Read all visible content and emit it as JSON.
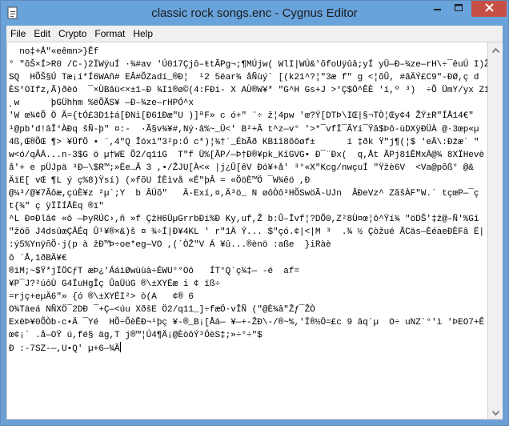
{
  "window": {
    "title": "classic rock songs.enc - Cygnus Editor",
    "controls": {
      "minimize_icon": "minimize-icon",
      "maximize_icon": "maximize-icon",
      "close_icon": "close-icon"
    }
  },
  "colors": {
    "titlebar": "#69a3dc",
    "close_button": "#c74f46",
    "editor_background": "#ffffff",
    "menubar_background": "#f0f0f0"
  },
  "menu": [
    "File",
    "Edit",
    "Crypto",
    "Format",
    "Help"
  ],
  "editor": {
    "lines": [
      "  no‡+Å\"«eêmn>}Êf",
      "° \"õŠ×Í>R0 /C-)2ÏWÿuÍ ·¾#av 'Ú017Çjô–ŧtÃPg¬;¶MÚjw( WlI|WÚ&'õfoUÿûâ;yÍ yÜ—Ð–¾ze—rH\\÷¯êuÚ I)Ž",
      "SQ  HÕŠ§Ú Tæ¡í*Í6WAñ# EÂ#ÕZadí_®Ð¦  ¹2 5ëar¾ åÑùý´ [(k21^?¦\"3æ f\" g <¦õÛ, #âÄÝ£C9\"-ÐØ,ç d",
      "ÈS°OIfz,Ã)ðèö  ¯×ÙBâü<×±1–Ð ¾Iï®ø©(4:FÐi- X AÙ®W¥* \"G^H Gs+J >°Ç$Ö^ÊÈ 'í,º ³)  ÷Õ ÜmY/yx Z1ÈŠ",
      "¸w      þGÜhhm %ëÕÃS¥ —Ð–¾ze—rHPÓ^x",
      "'W œ¾¢Õ Ö Ã={tÓ£3D1‡á[ÐNì[Ð61Ðæ\"U )]ªF» c ó+\" ¨÷ ž¦4pw 'œ?Ý[DTÞ\\IŒ|§¬TÒ¦Œy¢4 ŽÝ±R\"ÍÅ14€\"",
      "¹@pb'd!âÎ°ÀÐq šÑ-þ\" ¤:-  ·Ã§v¾¥#,Ný·â%~_Ü<' B²+Â t^z—v° '>*¯vfÏ¯ÃYí¯Ÿâ$Þô-ùDXÿÐÜÀ @·3œp«µ",
      "4ß,Œ®ÕŒ ¶> ¥ÜfÖ • ¨,4\"Q Îóxì\"3²p:Ó c*)¦¾†´_ÉbÃð KB1î8õôøf±      í ‡ðk Ÿ\"j¶(¦$ 'eÄ\\:Ðžæ´ \"",
      "w<ó/qÂÄ...n-3$G ö µ†WE Õ2/q11G  T\"f Ü%[ÃP/—Þ†Ð®¥pk_KîGVG• Ð¯¨Ðx(  q,Åt ÃPj81ÊMxÄ@¾ 8XÏHevè",
      "å'+ e pÜJpä ³Ð—\\$R™;»Ëe…Â 3 ,•/ŽJU[À<« |j¿Û[êV Ðó¥+å' ³°«X\"Kcg/nwçuÍ \"Ÿžè6V  <Va@põß° @&",
      "ÄïE[ vŒ ¶L ý ç%8)Ÿsí) (»fõU ÍÈìvå «É\"þÂ = «ÕöÈ™Ö ¯W¾êö ,Ð",
      "@¼³/@¥7Âôæ,çüÈ¥z ²µ`;Y  b ÂÚõ\"   Ä-Exí,¤,Ä³ö_ N øôÒô³HÕSwöÃ-UJn  ÂÐeVz^ ZãšÀF\"W.´ tçœP—¯ç",
      "t{¾\" ç ÿÏÏÍÅÈq ®ï\"",
      "^L Ð¤Ðlâ¢ «ô —ÞyRÚC›,ñ »f ÇžH6ÜµGrrbÐi%Ð Ky,uf,Ž b:Û–Îvf¦?DÕ0,Z²8Ù¤œ¦ô^Ÿí¾ \"öDŠ'‡ž@–Ñ'%Gî",
      "\"žöõ J4dsûœÇÂÉq Û¹¥®×&)š ¤ ¾÷Í|Ð¥4KL ' r\"1Ä Ý... $\"çó.¢|<|M ³  .¾ ½ Çòžué ÃCäs—ÈéaeÐÈFâ Ë|",
      ":ý5%YnÿñÕ·j(p à žÐ™Þ÷oe*eg—VO ,(´ÒŽ\"V Á ¥û...®ènö :aße  }iRàè",
      "ô ´Å,1ðBÄ¥€",
      "®iM;~$Ÿ*jÏÖCƒT æÞ¿'ÁáìØwùùà÷ÉWU°°Oô   ÍT°Q`ç¾‡— -é  af=",
      "¥P¯J?²úôÙ G4ÏuHgÎç ÛaÜüG ®\\±XYÉæ i ¢ ïß÷",
      "=rjç+eµÄ6\"» {ó ®\\±XYÉI²> ò(A   ¢® 6",
      "O¾Täeá NÑXÖ¯2DÐ ¯+Ç—<úu XðšE Ö2/q11_]÷fæÖ·vÎÑ (\"@È¾â\"Žƒ¯ŽÒ",
      "ExëÞ¥0ÕÒb-c•Ä ¯Yé  HÕ÷ÕèÊÐ¬¹þç ¥-®_B¡[Åá— ¥—+-ŽÐ\\-/®~%,'Ï®½Ö=£c 9 âq´µ  O÷ uNZ`°'ì 'ÞEO7+Ê",
      "œ¢¡´ .å—OŸ ú,fé§ äg,T j®™¦Ú4¶Ä¡@ÈòôÝ³ÓèS‡;»÷°÷\"$",
      "Ð :-7SZ-—,U•Q' µ+6—¾Ã"
    ]
  },
  "scrollbar": {
    "up_icon": "scroll-up-icon",
    "down_icon": "scroll-down-icon"
  }
}
